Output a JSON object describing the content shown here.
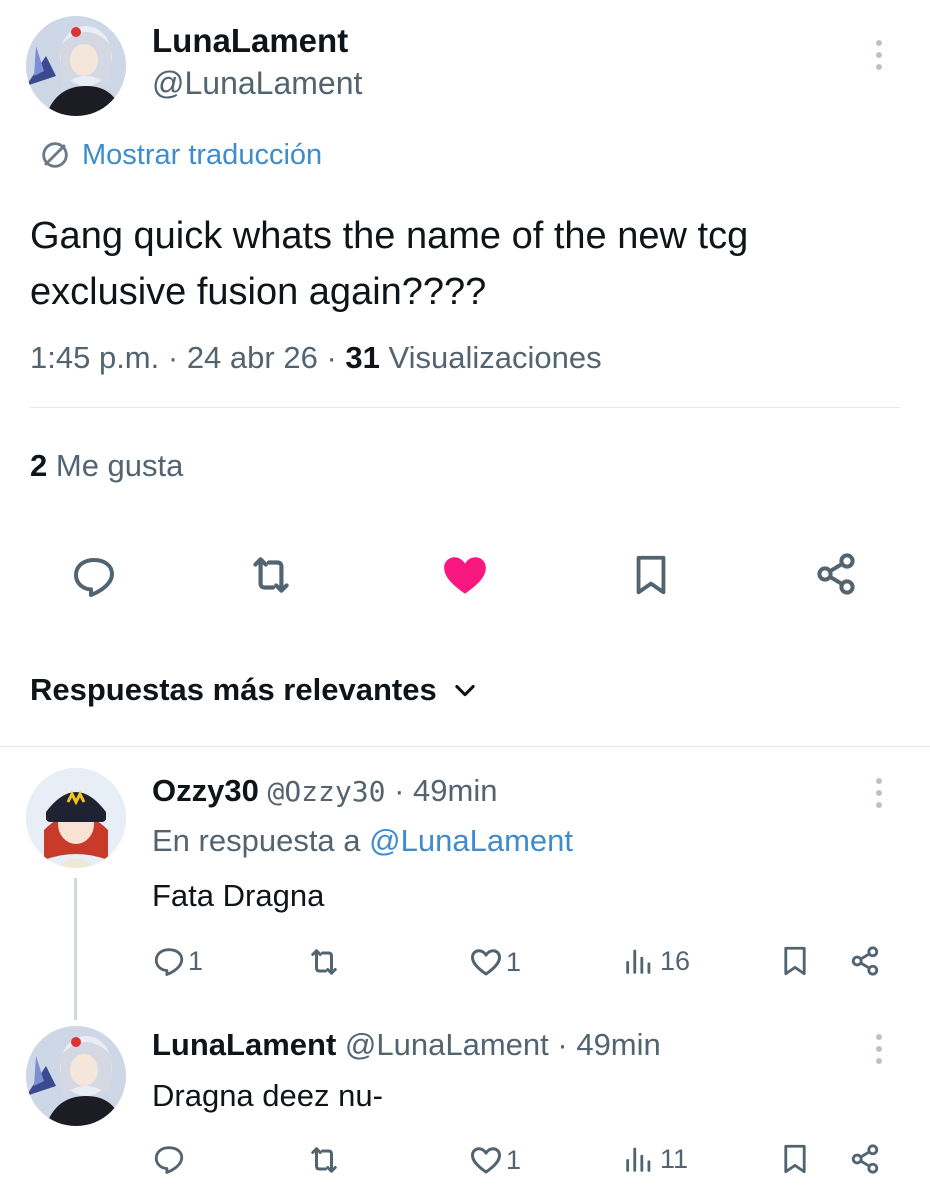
{
  "tweet": {
    "author": {
      "display_name": "LunaLament",
      "handle": "@LunaLament",
      "avatar_icon": "anime-avatar-icon"
    },
    "translate_label": "Mostrar traducción",
    "text_line1": "Gang quick whats the name of the new tcg",
    "text_line2": "exclusive fusion again????",
    "time": "1:45 p.m.",
    "date": "24 abr 26",
    "views_count": "31",
    "views_label": "Visualizaciones",
    "likes_count": "2",
    "likes_label": "Me gusta",
    "liked": true,
    "colors": {
      "like": "#f91880",
      "link": "#1d9bf0",
      "muted": "#536471"
    }
  },
  "replies_sort": {
    "label": "Respuestas más relevantes"
  },
  "replies": [
    {
      "display_name": "Ozzy30",
      "handle": "@Ozzy30",
      "time": "49min",
      "in_reply_prefix": "En respuesta a",
      "in_reply_handle": "@LunaLament",
      "text": "Fata Dragna",
      "reply_count": "1",
      "like_count": "1",
      "views_count": "16",
      "avatar_icon": "red-hair-avatar-icon"
    },
    {
      "display_name": "LunaLament",
      "handle": "@LunaLament",
      "time": "49min",
      "text": "Dragna deez nu-",
      "reply_count": "",
      "like_count": "1",
      "views_count": "11",
      "avatar_icon": "anime-avatar-icon"
    }
  ]
}
